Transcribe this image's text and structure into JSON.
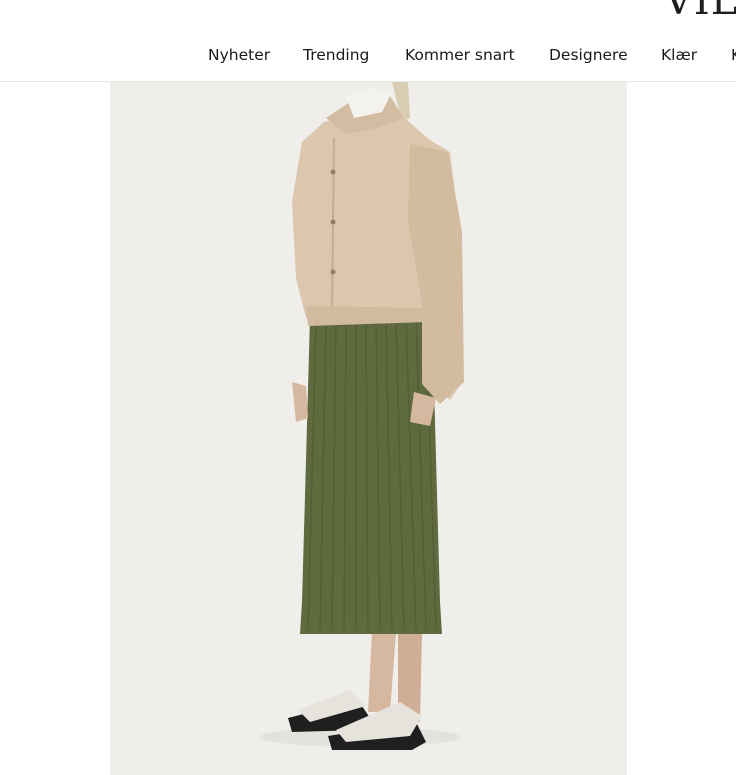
{
  "header": {
    "logo_text": "VIL",
    "nav": [
      {
        "label": "Nyheter"
      },
      {
        "label": "Trending"
      },
      {
        "label": "Kommer snart"
      },
      {
        "label": "Designere"
      },
      {
        "label": "Klær"
      },
      {
        "label": "K"
      }
    ]
  },
  "product_image": {
    "description_icon": "fashion-model-photo",
    "colors": {
      "background": "#efeeea",
      "jacket": "#dcc7ae",
      "skirt": "#5f6a3e",
      "sandals": "#e6e3dc"
    }
  }
}
